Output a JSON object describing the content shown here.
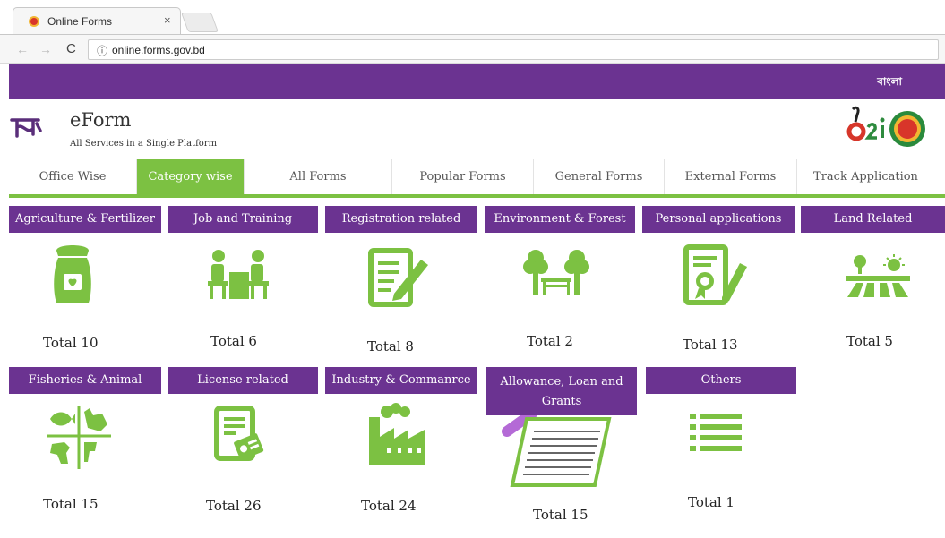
{
  "browser": {
    "tab_title": "Online Forms",
    "tab_close": "×",
    "back": "←",
    "forward": "→",
    "reload": "C",
    "info_icon": "ⓘ",
    "url": "online.forms.gov.bd"
  },
  "topbar": {
    "language_label": "বাংলা"
  },
  "header": {
    "brand": "eForm",
    "tagline": "All Services in a Single Platform"
  },
  "nav": {
    "items": [
      {
        "label": "Office Wise",
        "active": false
      },
      {
        "label": "Category wise",
        "active": true
      },
      {
        "label": "All Forms",
        "active": false
      },
      {
        "label": "Popular Forms",
        "active": false
      },
      {
        "label": "General Forms",
        "active": false
      },
      {
        "label": "External Forms",
        "active": false
      },
      {
        "label": "Track Application",
        "active": false
      }
    ]
  },
  "categories": [
    {
      "title": "Agriculture & Fertilizer",
      "total": "Total 10",
      "icon": "fertilizer-sack-icon"
    },
    {
      "title": "Job and Training",
      "total": "Total 6",
      "icon": "job-training-icon"
    },
    {
      "title": "Registration related",
      "total": "Total 8",
      "icon": "registration-form-icon"
    },
    {
      "title": "Environment & Forest",
      "total": "Total 2",
      "icon": "trees-bench-icon"
    },
    {
      "title": "Personal applications",
      "total": "Total 13",
      "icon": "certificate-icon"
    },
    {
      "title": "Land Related",
      "total": "Total 5",
      "icon": "land-field-icon"
    },
    {
      "title": "Fisheries & Animal",
      "total": "Total 15",
      "icon": "fish-animal-icon"
    },
    {
      "title": "License related",
      "total": "Total 26",
      "icon": "license-document-icon"
    },
    {
      "title": "Industry & Commanrce",
      "total": "Total 24",
      "icon": "factory-icon"
    },
    {
      "title": "Allowance, Loan and Grants",
      "total": "Total 15",
      "icon": "allowance-document-pen-icon"
    },
    {
      "title": "Others",
      "total": "Total 1",
      "icon": "list-icon"
    }
  ],
  "colors": {
    "purple": "#6b3391",
    "green": "#7cc142"
  }
}
